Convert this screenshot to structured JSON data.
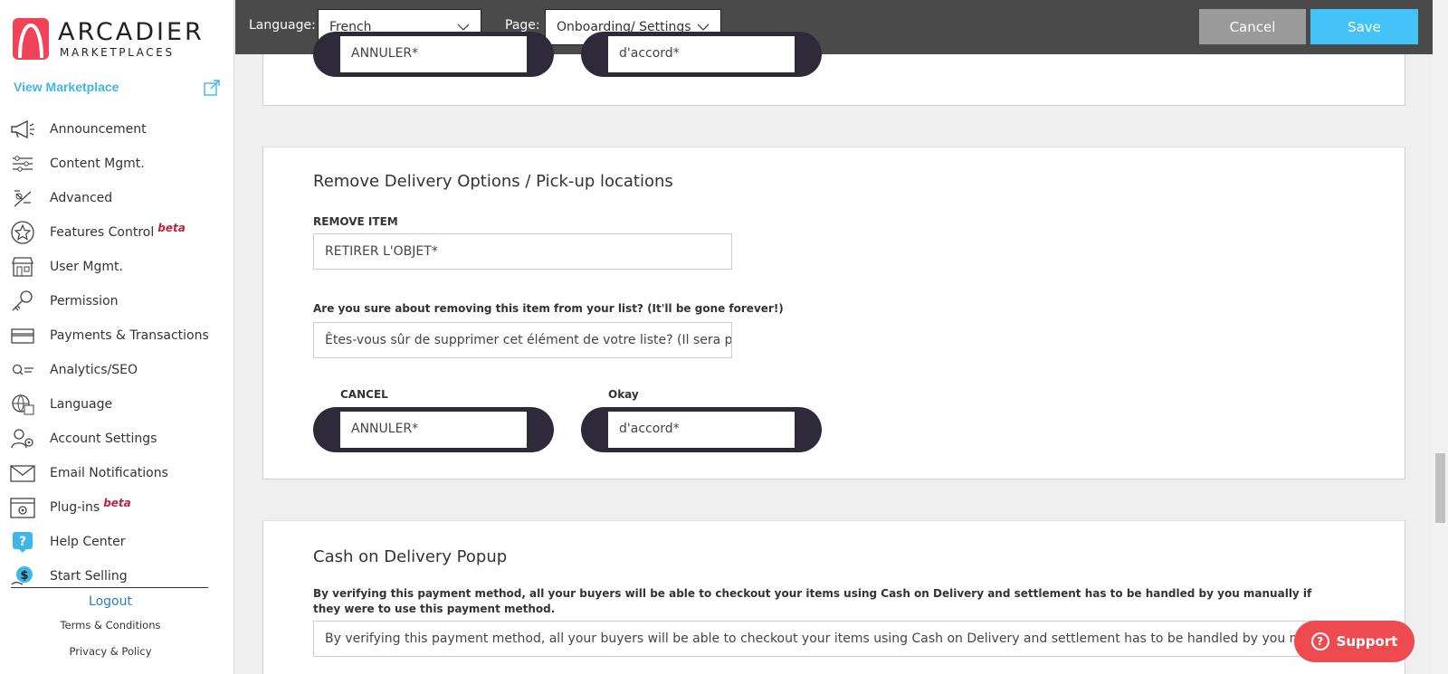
{
  "brand": {
    "name": "ARCADIER",
    "tagline": "MARKETPLACES",
    "color": "#f0435a"
  },
  "sidebar": {
    "view_marketplace": "View Marketplace",
    "items": [
      {
        "label": "Announcement",
        "icon": "megaphone-icon"
      },
      {
        "label": "Content Mgmt.",
        "icon": "sliders-icon"
      },
      {
        "label": "Advanced",
        "icon": "advanced-icon"
      },
      {
        "label": "Features Control",
        "icon": "star-icon",
        "badge": "beta"
      },
      {
        "label": "User Mgmt.",
        "icon": "storefront-icon"
      },
      {
        "label": "Permission",
        "icon": "key-icon"
      },
      {
        "label": "Payments & Transactions",
        "icon": "card-icon"
      },
      {
        "label": "Analytics/SEO",
        "icon": "search-list-icon"
      },
      {
        "label": "Language",
        "icon": "globe-icon"
      },
      {
        "label": "Account Settings",
        "icon": "user-gear-icon"
      },
      {
        "label": "Email Notifications",
        "icon": "envelope-icon"
      },
      {
        "label": "Plug-ins",
        "icon": "plugin-icon",
        "badge": "beta"
      },
      {
        "label": "Help Center",
        "icon": "help-icon"
      },
      {
        "label": "Start Selling",
        "icon": "dollar-icon"
      }
    ],
    "logout": "Logout",
    "terms": "Terms & Conditions",
    "privacy": "Privacy & Policy"
  },
  "topbar": {
    "language_label": "Language:",
    "language_value": "French",
    "page_label": "Page:",
    "page_value": "Onboarding/ Settings",
    "cancel": "Cancel",
    "save": "Save"
  },
  "section_prev": {
    "cancel_value": "ANNULER*",
    "okay_value": "d'accord*"
  },
  "section_remove": {
    "title": "Remove Delivery Options / Pick-up locations",
    "remove_item_label": "REMOVE ITEM",
    "remove_item_value": "RETIRER L'OBJET*",
    "confirm_label": "Are you sure about removing this item from your list? (It'll be gone forever!)",
    "confirm_value": "Êtes-vous sûr de supprimer cet élément de votre liste? (Il sera parti",
    "cancel_label": "CANCEL",
    "cancel_value": "ANNULER*",
    "okay_label": "Okay",
    "okay_value": "d'accord*"
  },
  "section_cod": {
    "title": "Cash on Delivery Popup",
    "desc_label": "By verifying this payment method, all your buyers will be able to checkout your items using Cash on Delivery and settlement has to be handled by you manually if they were to use this payment method.",
    "desc_value": "By verifying this payment method, all your buyers will be able to checkout your items using Cash on Delivery and settlement has to be handled by you manually if they were to use this payment method."
  },
  "support": {
    "label": "Support",
    "color": "#ee4b50"
  },
  "colors": {
    "topbar": "#4a4a4a",
    "save": "#43c3f7",
    "cancel": "#9b9b9b",
    "pill": "#2e2a3a",
    "link": "#3fb6e8"
  }
}
